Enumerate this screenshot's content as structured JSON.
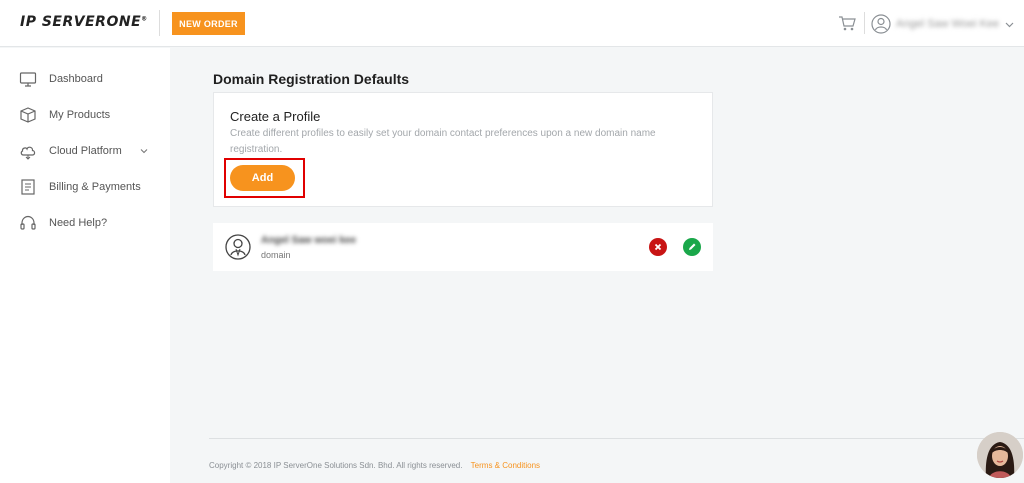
{
  "header": {
    "logo_text": "IP SERVERONE",
    "logo_mark": "®",
    "new_order_label": "NEW ORDER",
    "user_name": "Angel Saw Woei Kee",
    "cart_icon": "cart-icon",
    "user_icon": "user-circle-icon"
  },
  "sidebar": {
    "items": [
      {
        "label": "Dashboard",
        "icon": "monitor-icon"
      },
      {
        "label": "My Products",
        "icon": "box-icon"
      },
      {
        "label": "Cloud Platform",
        "icon": "cloud-icon"
      },
      {
        "label": "Billing & Payments",
        "icon": "invoice-icon"
      },
      {
        "label": "Need Help?",
        "icon": "headset-icon"
      }
    ]
  },
  "main": {
    "title": "Domain Registration Defaults",
    "create_card": {
      "title": "Create a Profile",
      "description": "Create different profiles to easily set your domain contact preferences upon a new domain name registration.",
      "add_label": "Add"
    },
    "profiles": [
      {
        "name": "Angel Saw woei kee",
        "type": "domain"
      }
    ]
  },
  "footer": {
    "copyright": "Copyright © 2018 IP ServerOne Solutions Sdn. Bhd. All rights reserved.",
    "terms_label": "Terms & Conditions"
  },
  "colors": {
    "accent": "#f7931e",
    "delete": "#c81414",
    "edit": "#1aa74a",
    "highlight": "#e00000"
  }
}
